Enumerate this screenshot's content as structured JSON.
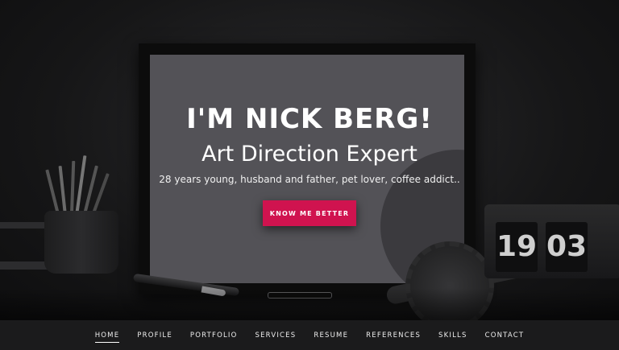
{
  "hero": {
    "title": "I'M NICK BERG!",
    "subtitle": "Art Direction Expert",
    "tagline": "28 years young, husband and father, pet lover, coffee addict..",
    "cta_label": "KNOW ME BETTER",
    "clock": {
      "hours": "19",
      "minutes": "03"
    }
  },
  "nav": {
    "items": [
      {
        "label": "HOME",
        "active": true
      },
      {
        "label": "PROFILE",
        "active": false
      },
      {
        "label": "PORTFOLIO",
        "active": false
      },
      {
        "label": "SERVICES",
        "active": false
      },
      {
        "label": "RESUME",
        "active": false
      },
      {
        "label": "REFERENCES",
        "active": false
      },
      {
        "label": "SKILLS",
        "active": false
      },
      {
        "label": "CONTACT",
        "active": false
      }
    ]
  },
  "colors": {
    "accent": "#d0134f",
    "nav_background": "#1b1b1c",
    "frame_mat": "#535257"
  }
}
